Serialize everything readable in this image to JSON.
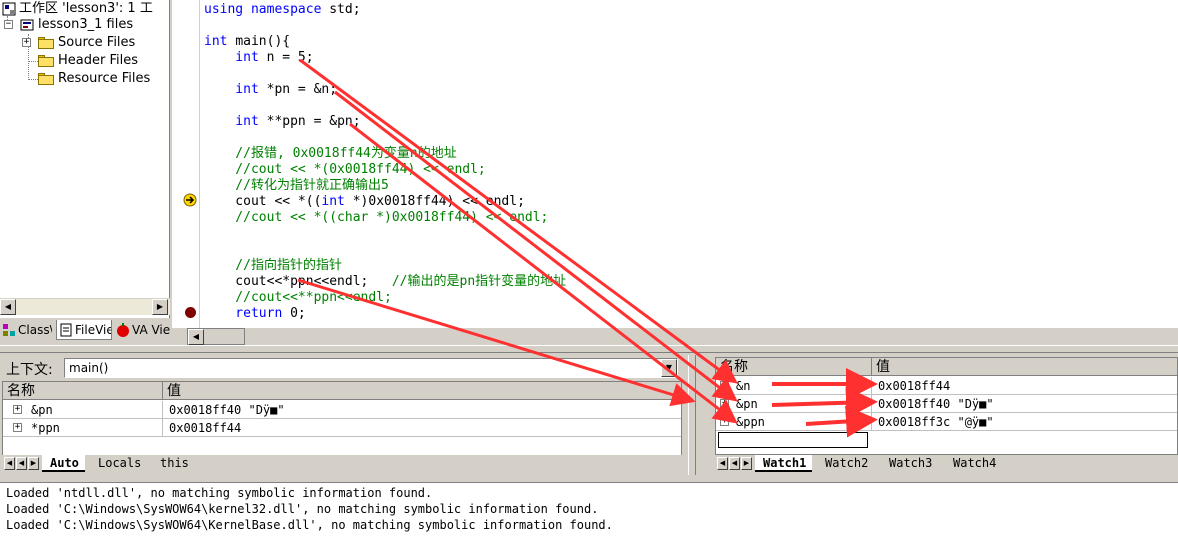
{
  "workspace": {
    "title": "工作区 'lesson3': 1 工",
    "project": "lesson3_1 files",
    "items": [
      {
        "label": "Source Files",
        "expandable": true
      },
      {
        "label": "Header Files",
        "expandable": false
      },
      {
        "label": "Resource Files",
        "expandable": false
      }
    ],
    "tabs": [
      {
        "label": "Class\\"
      },
      {
        "label": "FileVie"
      },
      {
        "label": "VA Vie"
      }
    ]
  },
  "editor": {
    "lines": [
      {
        "text": "using namespace std;",
        "style": "kw-mixed"
      },
      {
        "text": "",
        "style": "plain"
      },
      {
        "text": "int main(){",
        "style": "plain"
      },
      {
        "text": "    int n = 5;",
        "style": "plain"
      },
      {
        "text": "",
        "style": "plain"
      },
      {
        "text": "    int *pn = &n;",
        "style": "plain"
      },
      {
        "text": "",
        "style": "plain"
      },
      {
        "text": "    int **ppn = &pn;",
        "style": "plain"
      },
      {
        "text": "",
        "style": "plain"
      },
      {
        "text": "    //报错, 0x0018ff44为变量n的地址",
        "style": "comment"
      },
      {
        "text": "    //cout << *(0x0018ff44) << endl;",
        "style": "comment"
      },
      {
        "text": "    //转化为指针就正确输出5",
        "style": "comment"
      },
      {
        "text": "    cout << *((int *)0x0018ff44) << endl;",
        "style": "plain"
      },
      {
        "text": "    //cout << *((char *)0x0018ff44) << endl;",
        "style": "comment"
      },
      {
        "text": "",
        "style": "plain"
      },
      {
        "text": "",
        "style": "plain"
      },
      {
        "text": "    //指向指针的指针",
        "style": "comment"
      },
      {
        "text": "    cout<<*ppn<<endl;   //输出的是pn指针变量的地址",
        "style": "plain"
      },
      {
        "text": "    //cout<<**ppn<<endl;",
        "style": "comment"
      },
      {
        "text": "    return 0;",
        "style": "plain"
      }
    ]
  },
  "variables": {
    "context_label": "上下文:",
    "context_value": "main()",
    "col_name": "名称",
    "col_value": "值",
    "rows": [
      {
        "name": "&pn",
        "value": "0x0018ff40 \"Dÿ■\""
      },
      {
        "name": "*ppn",
        "value": "0x0018ff44"
      }
    ],
    "tabs": [
      "Auto",
      "Locals",
      "this"
    ]
  },
  "watch": {
    "col_name": "名称",
    "col_value": "值",
    "rows": [
      {
        "name": "&n",
        "value": "0x0018ff44"
      },
      {
        "name": "&pn",
        "value": "0x0018ff40 \"Dÿ■\""
      },
      {
        "name": "&ppn",
        "value": "0x0018ff3c \"@ÿ■\""
      }
    ],
    "tabs": [
      "Watch1",
      "Watch2",
      "Watch3",
      "Watch4"
    ]
  },
  "output": {
    "lines": [
      "Loaded 'ntdll.dll', no matching symbolic information found.",
      "Loaded 'C:\\Windows\\SysWOW64\\kernel32.dll', no matching symbolic information found.",
      "Loaded 'C:\\Windows\\SysWOW64\\KernelBase.dll', no matching symbolic information found."
    ]
  },
  "colors": {
    "keyword": "#0000ff",
    "comment": "#008000",
    "annotation_arrow": "#ff3030",
    "breakpoint": "#800000",
    "current_line_marker": "#ffd700"
  },
  "icons": [
    "workspace-icon",
    "project-icon",
    "folder-icon",
    "current-statement-arrow-icon",
    "breakpoint-icon"
  ]
}
